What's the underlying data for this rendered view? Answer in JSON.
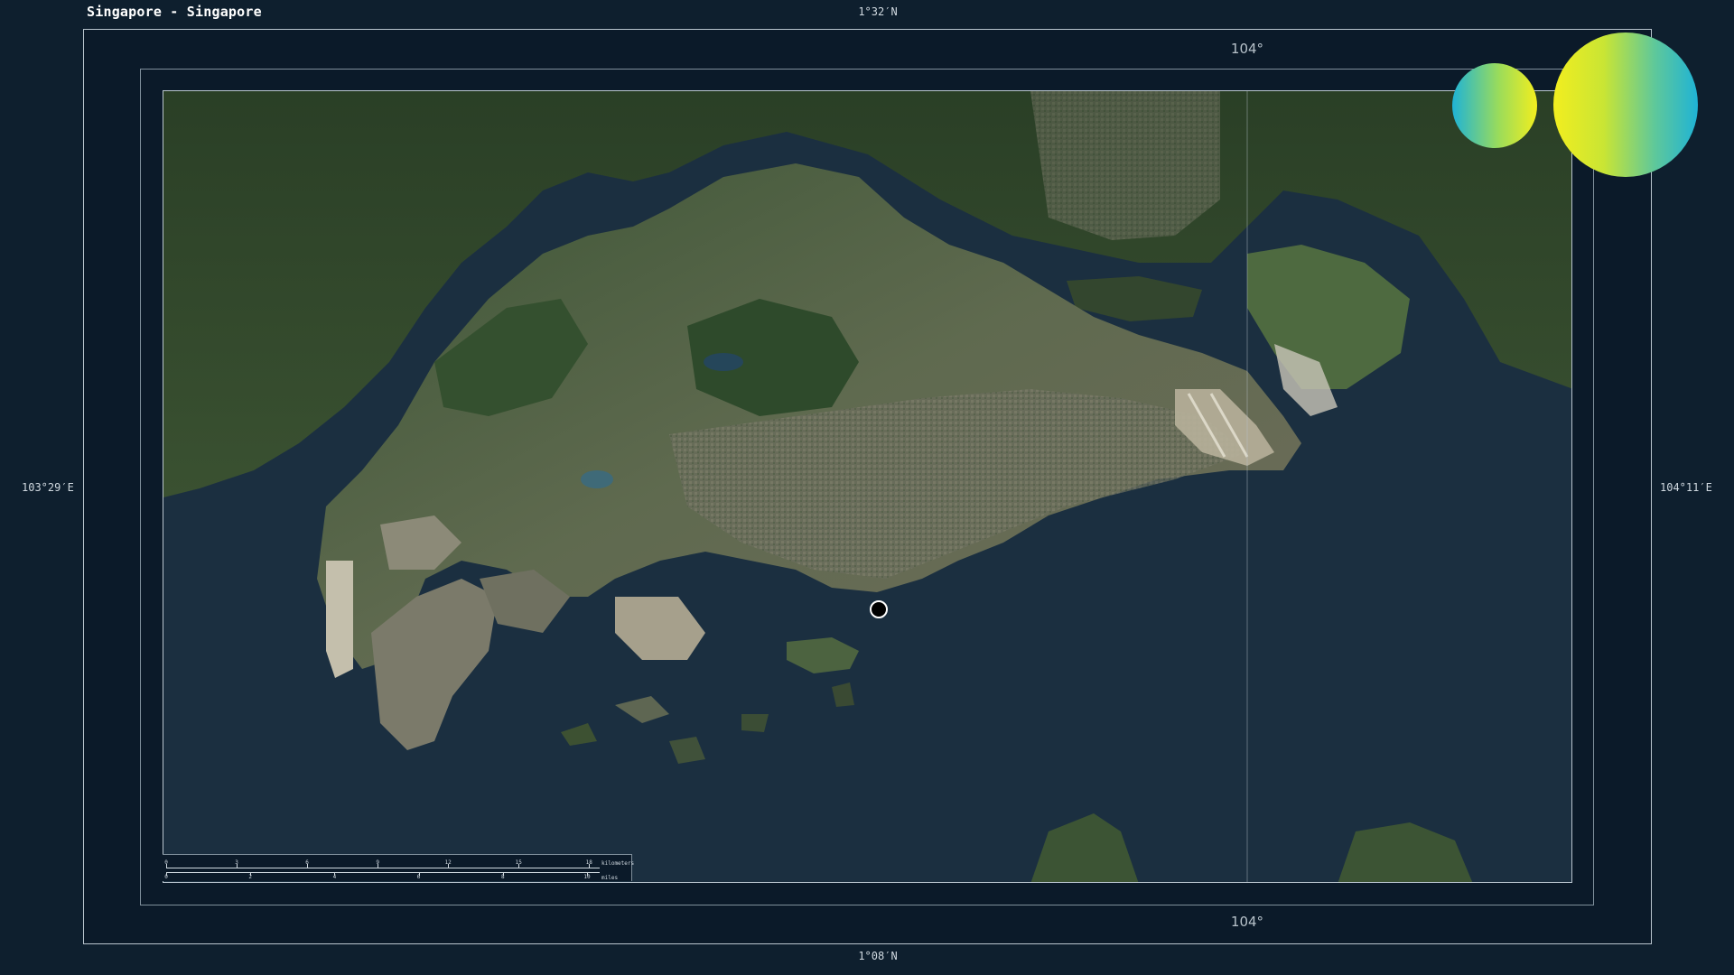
{
  "title": "Singapore - Singapore",
  "coords": {
    "top": "1°32′N",
    "bottom": "1°08′N",
    "left": "103°29′E",
    "right": "104°11′E"
  },
  "grid": {
    "top_label": "104°",
    "bottom_label": "104°"
  },
  "scalebar": {
    "km_ticks": [
      "0",
      "3",
      "6",
      "9",
      "12",
      "15",
      "18"
    ],
    "km_unit": "kilometers",
    "mi_ticks": [
      "0",
      "2",
      "4",
      "6",
      "8",
      "10"
    ],
    "mi_unit": "miles"
  },
  "legend_circles": {
    "gradient_colors": [
      "#1fb3d6",
      "#f2ee1f"
    ]
  },
  "colors": {
    "background": "#0e1f2e",
    "water": "#1b2f40",
    "land_urban": "#6b6f5a",
    "land_forest": "#2f4a2a",
    "frame": "#b9c5ce"
  },
  "location_marker": {
    "icon": "location-dot-icon"
  }
}
